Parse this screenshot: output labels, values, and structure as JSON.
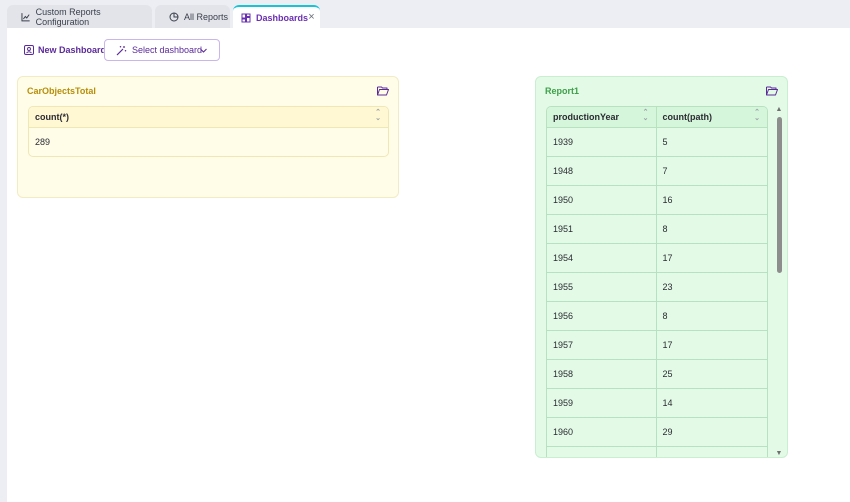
{
  "tabs": [
    {
      "label": "Custom Reports Configuration",
      "icon": "chart-line-icon",
      "active": false
    },
    {
      "label": "All Reports",
      "icon": "pie-chart-icon",
      "active": false
    },
    {
      "label": "Dashboards",
      "icon": "dashboard-icon",
      "active": true,
      "closable": true
    }
  ],
  "toolbar": {
    "new_dashboard_label": "New Dashboard",
    "select_dashboard_label": "Select dashboard"
  },
  "widgets": [
    {
      "title": "CarObjectsTotal",
      "color": "#fffde8",
      "title_color": "#b78e0a",
      "columns": [
        "count(*)"
      ],
      "rows": [
        [
          "289"
        ]
      ]
    },
    {
      "title": "Report1",
      "color": "#e3fbe6",
      "title_color": "#3f9f4a",
      "columns": [
        "productionYear",
        "count(path)"
      ],
      "rows": [
        [
          "1939",
          "5"
        ],
        [
          "1948",
          "7"
        ],
        [
          "1950",
          "16"
        ],
        [
          "1951",
          "8"
        ],
        [
          "1954",
          "17"
        ],
        [
          "1955",
          "23"
        ],
        [
          "1956",
          "8"
        ],
        [
          "1957",
          "17"
        ],
        [
          "1958",
          "25"
        ],
        [
          "1959",
          "14"
        ],
        [
          "1960",
          "29"
        ]
      ]
    }
  ],
  "colors": {
    "accent": "#6a2fb1",
    "tab_indicator": "#19c3d6"
  }
}
